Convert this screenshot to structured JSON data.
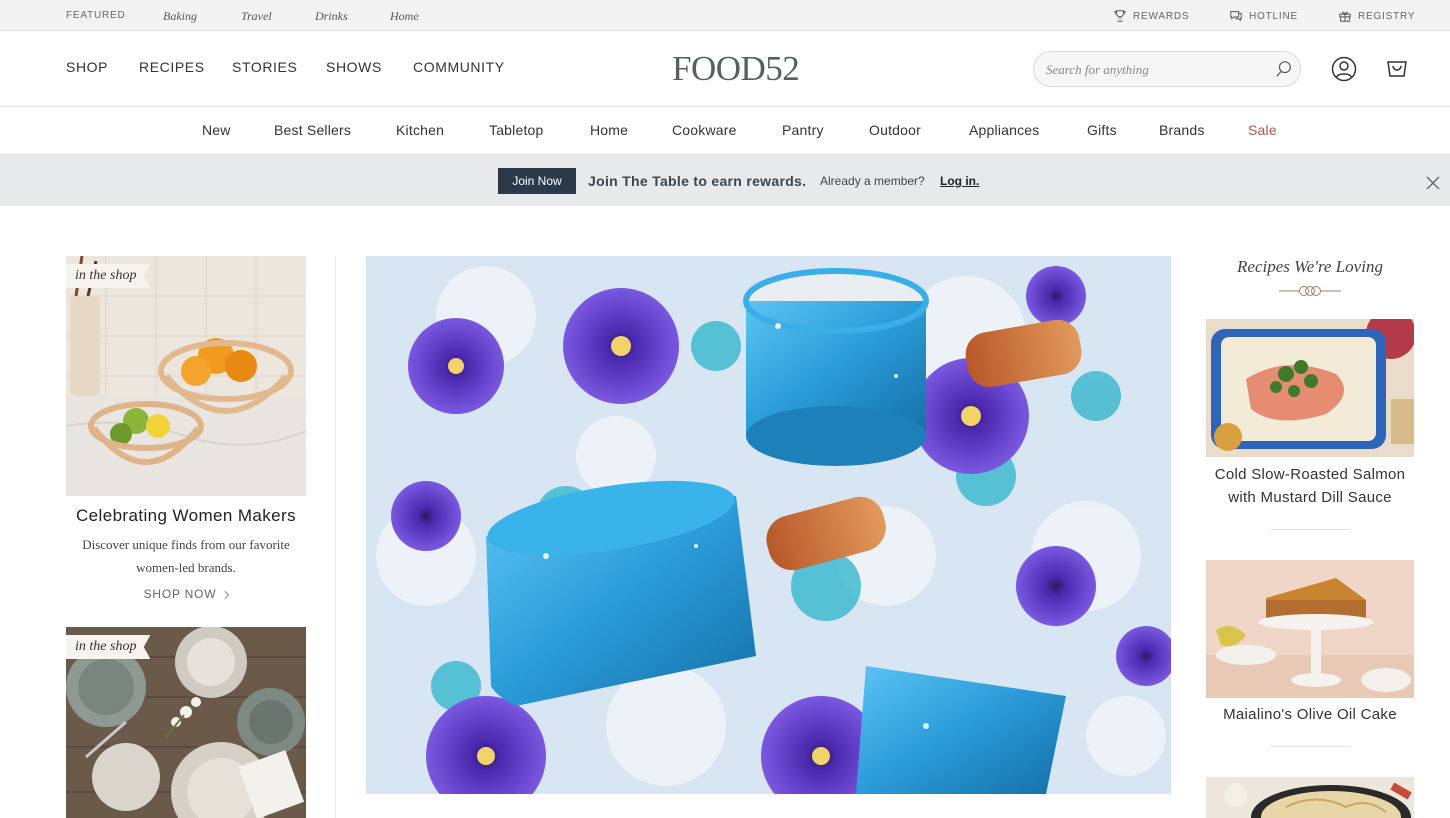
{
  "utility_bar": {
    "featured_label": "FEATURED",
    "links": [
      "Baking",
      "Travel",
      "Drinks",
      "Home"
    ],
    "rewards": "REWARDS",
    "hotline": "HOTLINE",
    "registry": "REGISTRY"
  },
  "header": {
    "logo": "FOOD52",
    "nav": [
      "SHOP",
      "RECIPES",
      "STORIES",
      "SHOWS",
      "COMMUNITY"
    ],
    "search_placeholder": "Search for anything"
  },
  "categories": [
    "New",
    "Best Sellers",
    "Kitchen",
    "Tabletop",
    "Home",
    "Cookware",
    "Pantry",
    "Outdoor",
    "Appliances",
    "Gifts",
    "Brands",
    "Sale"
  ],
  "promo": {
    "button": "Join Now",
    "message": "Join The Table to earn rewards.",
    "sub": "Already a member?",
    "login": "Log in."
  },
  "left_cards": {
    "tag": "in the shop",
    "title": "Celebrating Women Makers",
    "desc_line1": "Discover unique finds from our favorite",
    "desc_line2": "women-led brands.",
    "cta": "SHOP NOW",
    "second_tag": "in the shop"
  },
  "recipes": {
    "heading": "Recipes We're Loving",
    "items": [
      {
        "title_line1": "Cold Slow-Roasted Salmon",
        "title_line2": "with Mustard Dill Sauce"
      },
      {
        "title_line1": "Maialino's Olive Oil Cake"
      }
    ]
  },
  "colors": {
    "sale": "#b0564d",
    "join_button": "#2b3a48",
    "promo_bg": "#e8e9eb",
    "hero_blue": "#2a9bd8",
    "hero_purple": "#6a3fd0"
  }
}
